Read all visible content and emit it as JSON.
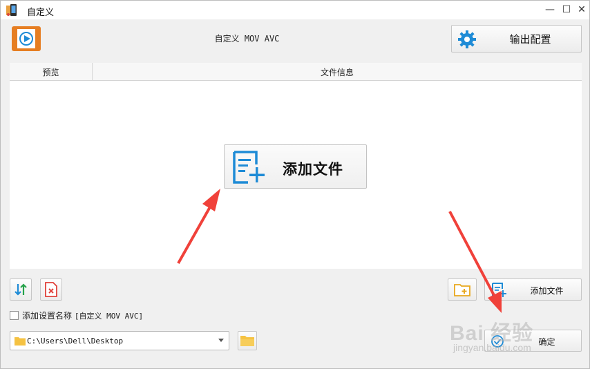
{
  "window": {
    "title": "自定义",
    "icons": {
      "app": "app-icon",
      "minimize": "minimize-icon",
      "maximize": "maximize-icon",
      "close": "close-icon"
    },
    "controls": {
      "minimize": "—",
      "maximize": "☐",
      "close": "✕"
    }
  },
  "header": {
    "preset_label": "自定义 MOV AVC",
    "output_config_label": "输出配置",
    "icons": {
      "logo": "video-logo-icon",
      "output": "gear-icon"
    }
  },
  "file_list": {
    "columns": [
      "预览",
      "文件信息"
    ],
    "add_file_label": "添加文件"
  },
  "toolbar": {
    "add_file_label": "添加文件",
    "icons": {
      "sort": "sort-icon",
      "delete": "delete-file-icon",
      "add_folder": "add-folder-icon",
      "add_file": "add-file-icon"
    }
  },
  "options": {
    "add_preset_name_label": "添加设置名称",
    "add_preset_name_value": "[自定义 MOV AVC]",
    "checked": false
  },
  "output": {
    "path": "C:\\Users\\Dell\\Desktop",
    "confirm_label": "确定",
    "icons": {
      "folder": "folder-icon",
      "browse": "browse-folder-icon",
      "confirm": "check-circle-icon",
      "dropdown": "chevron-down-icon"
    }
  },
  "watermark": {
    "text": "Bai 经验",
    "sub": "jingyan.baidu.com"
  },
  "colors": {
    "accent_blue": "#1e8bd6",
    "brand_orange": "#e67e22",
    "arrow_red": "#f0413a",
    "folder_yellow": "#f5c242"
  }
}
